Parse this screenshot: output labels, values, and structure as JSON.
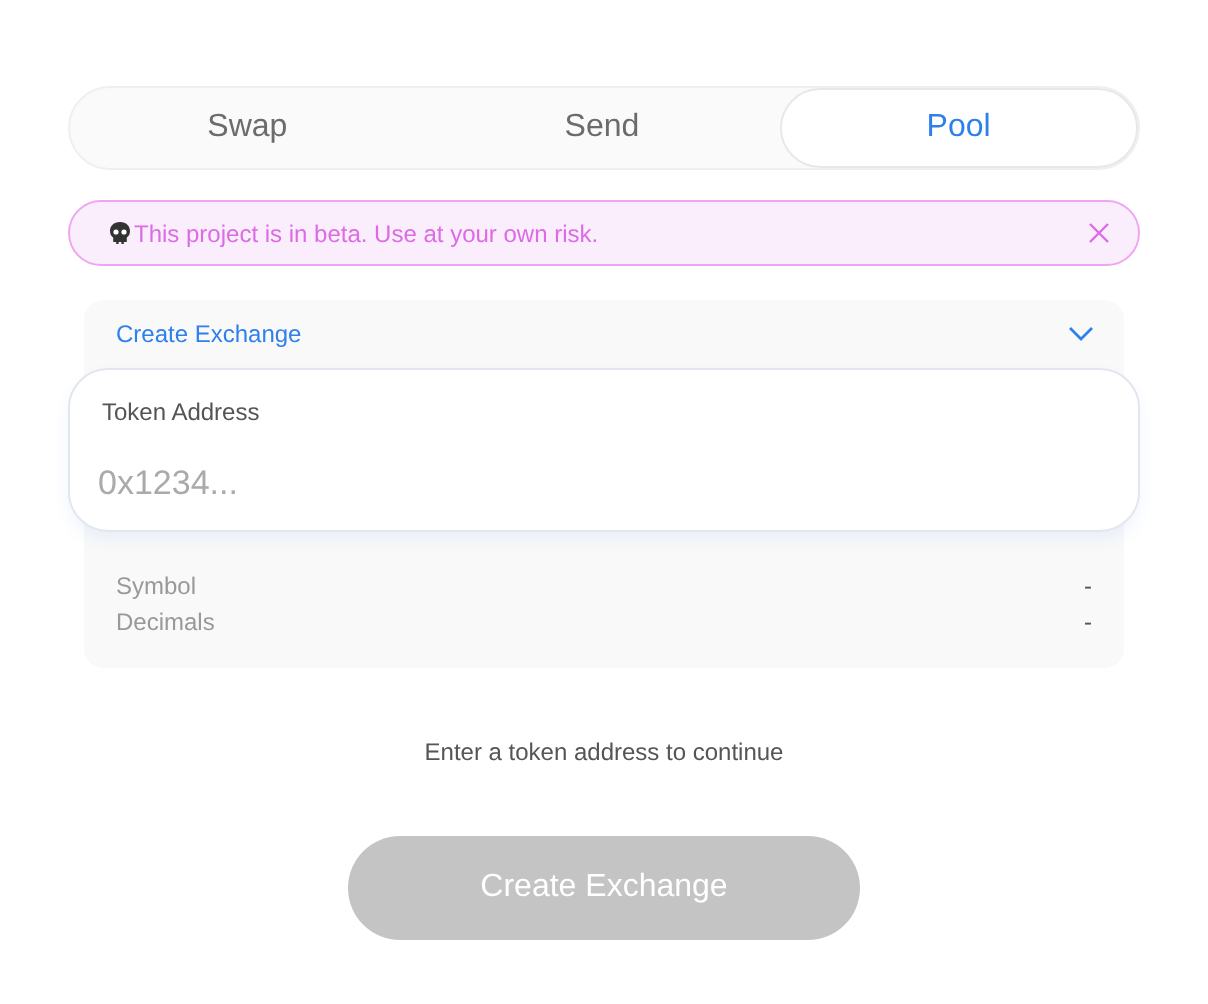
{
  "tabs": [
    {
      "label": "Swap",
      "selected": false
    },
    {
      "label": "Send",
      "selected": false
    },
    {
      "label": "Pool",
      "selected": true
    }
  ],
  "banner": {
    "text": "This project is in beta. Use at your own risk."
  },
  "panel": {
    "title": "Create Exchange",
    "expanded": true,
    "field": {
      "label": "Token Address",
      "placeholder": "0x1234..."
    },
    "rows": [
      {
        "label": "Symbol",
        "value": "-"
      },
      {
        "label": "Decimals",
        "value": "-"
      }
    ]
  },
  "hint": "Enter a token address to continue",
  "button": {
    "label": "Create Exchange",
    "disabled": true
  }
}
